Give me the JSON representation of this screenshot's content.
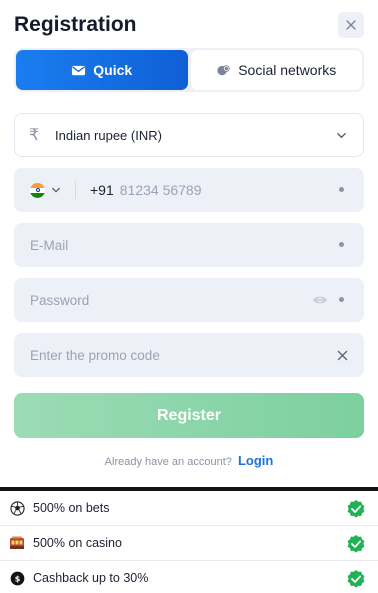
{
  "modal": {
    "title": "Registration"
  },
  "tabs": [
    {
      "label": "Quick",
      "icon": "envelope-icon",
      "active": true
    },
    {
      "label": "Social networks",
      "icon": "chat-bubbles-icon",
      "active": false
    }
  ],
  "currency": {
    "icon": "rupee-icon",
    "value": "Indian rupee (INR)"
  },
  "phone": {
    "country_flag": "india-flag-icon",
    "dial_code": "+91",
    "placeholder": "81234 56789"
  },
  "email": {
    "placeholder": "E-Mail"
  },
  "password": {
    "placeholder": "Password"
  },
  "promo": {
    "placeholder": "Enter the promo code"
  },
  "register_button": "Register",
  "login_prompt": {
    "text": "Already have an account?",
    "link": "Login"
  },
  "bonuses": [
    {
      "icon": "soccer-ball-icon",
      "label": "500% on bets"
    },
    {
      "icon": "casino-icon",
      "label": "500% on casino"
    },
    {
      "icon": "cashback-icon",
      "label": "Cashback up to 30%"
    }
  ],
  "colors": {
    "accent_blue": "#1a7ef0",
    "register_green": "#8bd5aa",
    "check_green": "#1fb354",
    "field_bg": "#edf0f7"
  }
}
